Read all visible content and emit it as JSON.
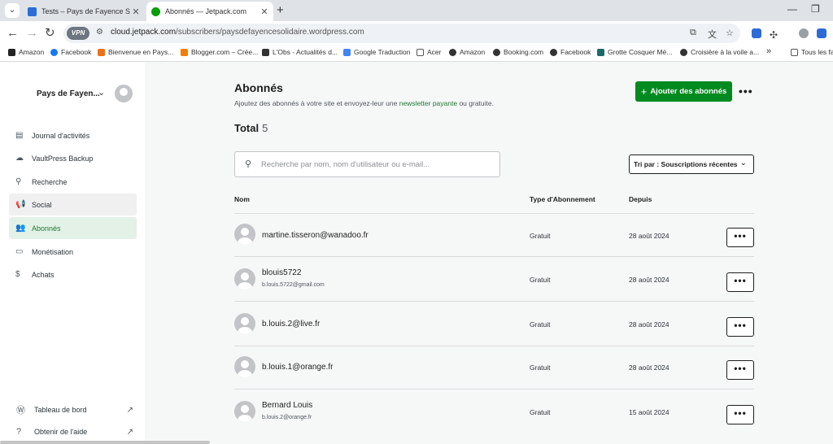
{
  "browser": {
    "tabs": [
      {
        "title": "Tests – Pays de Fayence Solidaire",
        "active": false
      },
      {
        "title": "Abonnés — Jetpack.com",
        "active": true
      }
    ],
    "url_host": "cloud.jetpack.com",
    "url_path": "/subscribers/paysdefayencesolidaire.wordpress.com",
    "vpn_label": "VPN",
    "bookmarks": [
      "Amazon",
      "Facebook",
      "Bienvenue en Pays...",
      "Blogger.com – Crée...",
      "L'Obs - Actualités d...",
      "Google Traduction",
      "Acer",
      "Amazon",
      "Booking.com",
      "Facebook",
      "Grotte Cosquer Mé...",
      "Croisière à la voile a..."
    ],
    "bookmarks_overflow": "»",
    "all_bookmarks": "Tous les fav"
  },
  "sidebar": {
    "site_name": "Pays de Fayen...",
    "items": [
      {
        "label": "Journal d'activités",
        "icon": "activity-log-icon"
      },
      {
        "label": "VaultPress Backup",
        "icon": "backup-icon"
      },
      {
        "label": "Recherche",
        "icon": "search-icon"
      },
      {
        "label": "Social",
        "icon": "megaphone-icon"
      },
      {
        "label": "Abonnés",
        "icon": "people-icon"
      },
      {
        "label": "Monétisation",
        "icon": "card-icon"
      },
      {
        "label": "Achats",
        "icon": "dollar-icon"
      }
    ],
    "footer": [
      {
        "label": "Tableau de bord",
        "icon": "wordpress-icon"
      },
      {
        "label": "Obtenir de l'aide",
        "icon": "help-icon"
      }
    ]
  },
  "main": {
    "title": "Abonnés",
    "subtitle_before": "Ajoutez des abonnés à votre site et envoyez-leur une ",
    "subtitle_link": "newsletter payante",
    "subtitle_after": " ou gratuite.",
    "add_button": "Ajouter des abonnés",
    "total_label": "Total",
    "total_count": "5",
    "search_placeholder": "Recherche par nom, nom d'utilisateur ou e-mail...",
    "sort_label": "Tri par : Souscriptions récentes",
    "columns": {
      "name": "Nom",
      "type": "Type d'Abonnement",
      "since": "Depuis"
    },
    "rows": [
      {
        "name": "martine.tisseron@wanadoo.fr",
        "email": "",
        "type": "Gratuit",
        "since": "28 août 2024"
      },
      {
        "name": "blouis5722",
        "email": "b.louis.5722@gmail.com",
        "type": "Gratuit",
        "since": "28 août 2024"
      },
      {
        "name": "b.louis.2@live.fr",
        "email": "",
        "type": "Gratuit",
        "since": "28 août 2024"
      },
      {
        "name": "b.louis.1@orange.fr",
        "email": "",
        "type": "Gratuit",
        "since": "28 août 2024"
      },
      {
        "name": "Bernard Louis",
        "email": "b.louis.2@orange.fr",
        "type": "Gratuit",
        "since": "15 août 2024"
      }
    ]
  },
  "colors": {
    "accent": "#008a20",
    "active_bg": "#e3f1e6",
    "link": "#1e7a34"
  }
}
